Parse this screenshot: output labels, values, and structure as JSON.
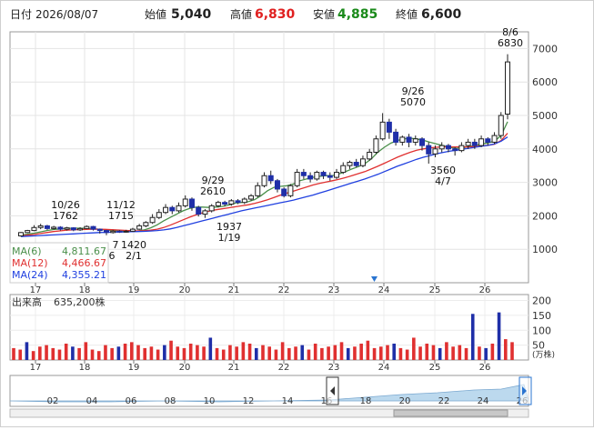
{
  "header": {
    "date_label": "日付",
    "date": "2026/08/07",
    "open_label": "始値",
    "open": "5,040",
    "high_label": "高値",
    "high": "6,830",
    "low_label": "安値",
    "low": "4,885",
    "close_label": "終値",
    "close": "6,600",
    "colors": {
      "open": "#222222",
      "high": "#e02020",
      "low": "#1a8a1a",
      "close": "#222222"
    }
  },
  "legend": {
    "ma6_label": "MA(6)",
    "ma6_value": "4,811.67",
    "ma12_label": "MA(12)",
    "ma12_value": "4,466.67",
    "ma24_label": "MA(24)",
    "ma24_value": "4,355.21",
    "colors": {
      "ma6": "#4a8f4a",
      "ma12": "#e03030",
      "ma24": "#2040e0"
    }
  },
  "volume_panel": {
    "title_label": "出来高",
    "title_value": "635,200株",
    "unit": "(万株)"
  },
  "chart_data": [
    {
      "type": "candlestick",
      "ylim": [
        0,
        7500
      ],
      "y_ticks": [
        1000,
        2000,
        3000,
        4000,
        5000,
        6000,
        7000
      ],
      "x_ticks": [
        "17",
        "18",
        "19",
        "20",
        "21",
        "22",
        "23",
        "24",
        "25",
        "26"
      ],
      "grid": true,
      "annotations": [
        {
          "date": "10/26",
          "value": "1762",
          "position": "above"
        },
        {
          "date": "11/12",
          "value": "1715",
          "position": "above"
        },
        {
          "date": "9/29",
          "value": "2610",
          "position": "above"
        },
        {
          "date": "9/26",
          "value": "5070",
          "position": "above"
        },
        {
          "date": "8/6",
          "value": "6830",
          "position": "above"
        },
        {
          "date": "1/19",
          "value": "1937",
          "position": "below"
        },
        {
          "date": "4/7",
          "value": "3560",
          "position": "below"
        },
        {
          "date": "2/1",
          "value": "1420",
          "position": "below"
        },
        {
          "date": "6",
          "value": "7",
          "position": "below"
        }
      ],
      "candles": [
        {
          "o": 1400,
          "c": 1500,
          "h": 1520,
          "l": 1380
        },
        {
          "o": 1500,
          "c": 1560,
          "h": 1580,
          "l": 1480
        },
        {
          "o": 1560,
          "c": 1650,
          "h": 1720,
          "l": 1540
        },
        {
          "o": 1650,
          "c": 1700,
          "h": 1762,
          "l": 1600
        },
        {
          "o": 1700,
          "c": 1620,
          "h": 1730,
          "l": 1580
        },
        {
          "o": 1620,
          "c": 1660,
          "h": 1700,
          "l": 1590
        },
        {
          "o": 1660,
          "c": 1600,
          "h": 1690,
          "l": 1560
        },
        {
          "o": 1600,
          "c": 1640,
          "h": 1670,
          "l": 1560
        },
        {
          "o": 1640,
          "c": 1580,
          "h": 1660,
          "l": 1540
        },
        {
          "o": 1580,
          "c": 1620,
          "h": 1660,
          "l": 1550
        },
        {
          "o": 1620,
          "c": 1680,
          "h": 1715,
          "l": 1600
        },
        {
          "o": 1680,
          "c": 1600,
          "h": 1700,
          "l": 1560
        },
        {
          "o": 1600,
          "c": 1560,
          "h": 1620,
          "l": 1470
        },
        {
          "o": 1560,
          "c": 1500,
          "h": 1580,
          "l": 1420
        },
        {
          "o": 1500,
          "c": 1540,
          "h": 1580,
          "l": 1470
        },
        {
          "o": 1540,
          "c": 1520,
          "h": 1570,
          "l": 1490
        },
        {
          "o": 1520,
          "c": 1540,
          "h": 1580,
          "l": 1500
        },
        {
          "o": 1540,
          "c": 1600,
          "h": 1640,
          "l": 1520
        },
        {
          "o": 1600,
          "c": 1700,
          "h": 1760,
          "l": 1580
        },
        {
          "o": 1700,
          "c": 1800,
          "h": 1840,
          "l": 1660
        },
        {
          "o": 1800,
          "c": 1950,
          "h": 2050,
          "l": 1760
        },
        {
          "o": 1950,
          "c": 2100,
          "h": 2200,
          "l": 1900
        },
        {
          "o": 2100,
          "c": 2250,
          "h": 2350,
          "l": 2050
        },
        {
          "o": 2250,
          "c": 2150,
          "h": 2300,
          "l": 2050
        },
        {
          "o": 2150,
          "c": 2300,
          "h": 2400,
          "l": 2100
        },
        {
          "o": 2300,
          "c": 2500,
          "h": 2610,
          "l": 2250
        },
        {
          "o": 2500,
          "c": 2250,
          "h": 2550,
          "l": 2150
        },
        {
          "o": 2250,
          "c": 2050,
          "h": 2300,
          "l": 1980
        },
        {
          "o": 2050,
          "c": 2150,
          "h": 2200,
          "l": 1937
        },
        {
          "o": 2150,
          "c": 2300,
          "h": 2350,
          "l": 2100
        },
        {
          "o": 2300,
          "c": 2400,
          "h": 2450,
          "l": 2250
        },
        {
          "o": 2400,
          "c": 2350,
          "h": 2450,
          "l": 2280
        },
        {
          "o": 2350,
          "c": 2450,
          "h": 2500,
          "l": 2300
        },
        {
          "o": 2450,
          "c": 2400,
          "h": 2500,
          "l": 2350
        },
        {
          "o": 2400,
          "c": 2500,
          "h": 2550,
          "l": 2350
        },
        {
          "o": 2500,
          "c": 2600,
          "h": 2650,
          "l": 2450
        },
        {
          "o": 2600,
          "c": 2900,
          "h": 3000,
          "l": 2550
        },
        {
          "o": 2900,
          "c": 3200,
          "h": 3300,
          "l": 2850
        },
        {
          "o": 3200,
          "c": 3050,
          "h": 3350,
          "l": 2950
        },
        {
          "o": 3050,
          "c": 2800,
          "h": 3100,
          "l": 2700
        },
        {
          "o": 2800,
          "c": 2600,
          "h": 2850,
          "l": 2550
        },
        {
          "o": 2600,
          "c": 2900,
          "h": 2950,
          "l": 2550
        },
        {
          "o": 2900,
          "c": 3300,
          "h": 3400,
          "l": 2850
        },
        {
          "o": 3300,
          "c": 3200,
          "h": 3400,
          "l": 3100
        },
        {
          "o": 3200,
          "c": 3100,
          "h": 3300,
          "l": 3000
        },
        {
          "o": 3100,
          "c": 3300,
          "h": 3350,
          "l": 3050
        },
        {
          "o": 3300,
          "c": 3200,
          "h": 3350,
          "l": 3100
        },
        {
          "o": 3200,
          "c": 3150,
          "h": 3300,
          "l": 3050
        },
        {
          "o": 3150,
          "c": 3300,
          "h": 3400,
          "l": 3100
        },
        {
          "o": 3300,
          "c": 3500,
          "h": 3600,
          "l": 3250
        },
        {
          "o": 3500,
          "c": 3600,
          "h": 3650,
          "l": 3400
        },
        {
          "o": 3600,
          "c": 3500,
          "h": 3700,
          "l": 3450
        },
        {
          "o": 3500,
          "c": 3700,
          "h": 3800,
          "l": 3450
        },
        {
          "o": 3700,
          "c": 3900,
          "h": 4000,
          "l": 3650
        },
        {
          "o": 3900,
          "c": 4300,
          "h": 4400,
          "l": 3850
        },
        {
          "o": 4300,
          "c": 4800,
          "h": 5070,
          "l": 4250
        },
        {
          "o": 4800,
          "c": 4500,
          "h": 4900,
          "l": 4300
        },
        {
          "o": 4500,
          "c": 4200,
          "h": 4600,
          "l": 4100
        },
        {
          "o": 4200,
          "c": 4350,
          "h": 4400,
          "l": 4100
        },
        {
          "o": 4350,
          "c": 4200,
          "h": 4450,
          "l": 4050
        },
        {
          "o": 4200,
          "c": 4300,
          "h": 4400,
          "l": 4100
        },
        {
          "o": 4300,
          "c": 4100,
          "h": 4350,
          "l": 3950
        },
        {
          "o": 4100,
          "c": 3850,
          "h": 4200,
          "l": 3560
        },
        {
          "o": 3850,
          "c": 4000,
          "h": 4100,
          "l": 3750
        },
        {
          "o": 4000,
          "c": 4100,
          "h": 4200,
          "l": 3900
        },
        {
          "o": 4100,
          "c": 4000,
          "h": 4150,
          "l": 3900
        },
        {
          "o": 4000,
          "c": 3950,
          "h": 4050,
          "l": 3800
        },
        {
          "o": 3950,
          "c": 4100,
          "h": 4200,
          "l": 3900
        },
        {
          "o": 4100,
          "c": 4200,
          "h": 4300,
          "l": 4000
        },
        {
          "o": 4200,
          "c": 4100,
          "h": 4300,
          "l": 4000
        },
        {
          "o": 4100,
          "c": 4300,
          "h": 4400,
          "l": 4050
        },
        {
          "o": 4300,
          "c": 4200,
          "h": 4350,
          "l": 4100
        },
        {
          "o": 4200,
          "c": 4400,
          "h": 4500,
          "l": 4150
        },
        {
          "o": 4400,
          "c": 5000,
          "h": 5100,
          "l": 4300
        },
        {
          "o": 5040,
          "c": 6600,
          "h": 6830,
          "l": 4885
        }
      ]
    },
    {
      "type": "line",
      "series": [
        {
          "name": "MA(6)",
          "values": [
            1420,
            1450,
            1480,
            1520,
            1560,
            1590,
            1610,
            1620,
            1630,
            1630,
            1625,
            1620,
            1600,
            1580,
            1560,
            1550,
            1540,
            1535,
            1545,
            1580,
            1640,
            1730,
            1850,
            1950,
            2050,
            2150,
            2220,
            2260,
            2260,
            2250,
            2260,
            2280,
            2320,
            2380,
            2400,
            2420,
            2480,
            2600,
            2750,
            2850,
            2880,
            2900,
            2950,
            3050,
            3100,
            3150,
            3180,
            3200,
            3200,
            3250,
            3320,
            3400,
            3470,
            3560,
            3700,
            3900,
            4050,
            4170,
            4250,
            4300,
            4320,
            4300,
            4260,
            4200,
            4150,
            4100,
            4050,
            4020,
            4030,
            4070,
            4100,
            4150,
            4180,
            4230,
            4400,
            4811.67
          ]
        },
        {
          "name": "MA(12)",
          "values": [
            1400,
            1420,
            1440,
            1470,
            1500,
            1530,
            1550,
            1570,
            1580,
            1590,
            1595,
            1600,
            1600,
            1595,
            1585,
            1575,
            1565,
            1555,
            1550,
            1555,
            1570,
            1600,
            1650,
            1720,
            1800,
            1880,
            1960,
            2030,
            2090,
            2140,
            2180,
            2210,
            2240,
            2270,
            2300,
            2330,
            2370,
            2420,
            2480,
            2550,
            2620,
            2680,
            2740,
            2800,
            2860,
            2920,
            2970,
            3010,
            3050,
            3090,
            3140,
            3200,
            3260,
            3320,
            3400,
            3480,
            3570,
            3660,
            3750,
            3830,
            3900,
            3960,
            4000,
            4030,
            4050,
            4060,
            4060,
            4060,
            4060,
            4060,
            4070,
            4090,
            4110,
            4140,
            4250,
            4466.67
          ]
        },
        {
          "name": "MA(24)",
          "values": [
            1380,
            1390,
            1400,
            1410,
            1420,
            1430,
            1440,
            1450,
            1460,
            1470,
            1480,
            1490,
            1500,
            1505,
            1510,
            1515,
            1520,
            1525,
            1530,
            1535,
            1545,
            1560,
            1580,
            1610,
            1650,
            1700,
            1750,
            1800,
            1850,
            1900,
            1950,
            2000,
            2050,
            2100,
            2150,
            2190,
            2230,
            2270,
            2310,
            2350,
            2390,
            2430,
            2470,
            2520,
            2570,
            2620,
            2680,
            2740,
            2800,
            2860,
            2920,
            2980,
            3040,
            3100,
            3170,
            3240,
            3320,
            3400,
            3480,
            3550,
            3620,
            3690,
            3750,
            3800,
            3850,
            3890,
            3930,
            3960,
            3990,
            4020,
            4050,
            4080,
            4110,
            4150,
            4230,
            4355.21
          ]
        }
      ]
    },
    {
      "type": "bar",
      "ylim": [
        0,
        220
      ],
      "y_ticks": [
        50,
        100,
        150,
        200
      ],
      "x_ticks": [
        "17",
        "18",
        "19",
        "20",
        "21",
        "22",
        "23",
        "24",
        "25",
        "26"
      ],
      "values": [
        40,
        35,
        60,
        30,
        45,
        50,
        40,
        35,
        55,
        45,
        40,
        60,
        35,
        30,
        50,
        40,
        45,
        55,
        60,
        50,
        40,
        45,
        35,
        50,
        65,
        45,
        40,
        55,
        50,
        45,
        75,
        40,
        35,
        50,
        45,
        60,
        55,
        40,
        50,
        45,
        35,
        60,
        40,
        45,
        50,
        35,
        55,
        40,
        45,
        50,
        60,
        40,
        45,
        55,
        65,
        40,
        45,
        50,
        55,
        40,
        35,
        75,
        45,
        55,
        50,
        40,
        60,
        45,
        50,
        40,
        155,
        45,
        40,
        55,
        160,
        70,
        60
      ]
    }
  ],
  "navigator": {
    "labels": [
      "02",
      "04",
      "06",
      "08",
      "10",
      "12",
      "14",
      "16",
      "18",
      "20",
      "22",
      "24",
      "26"
    ]
  }
}
